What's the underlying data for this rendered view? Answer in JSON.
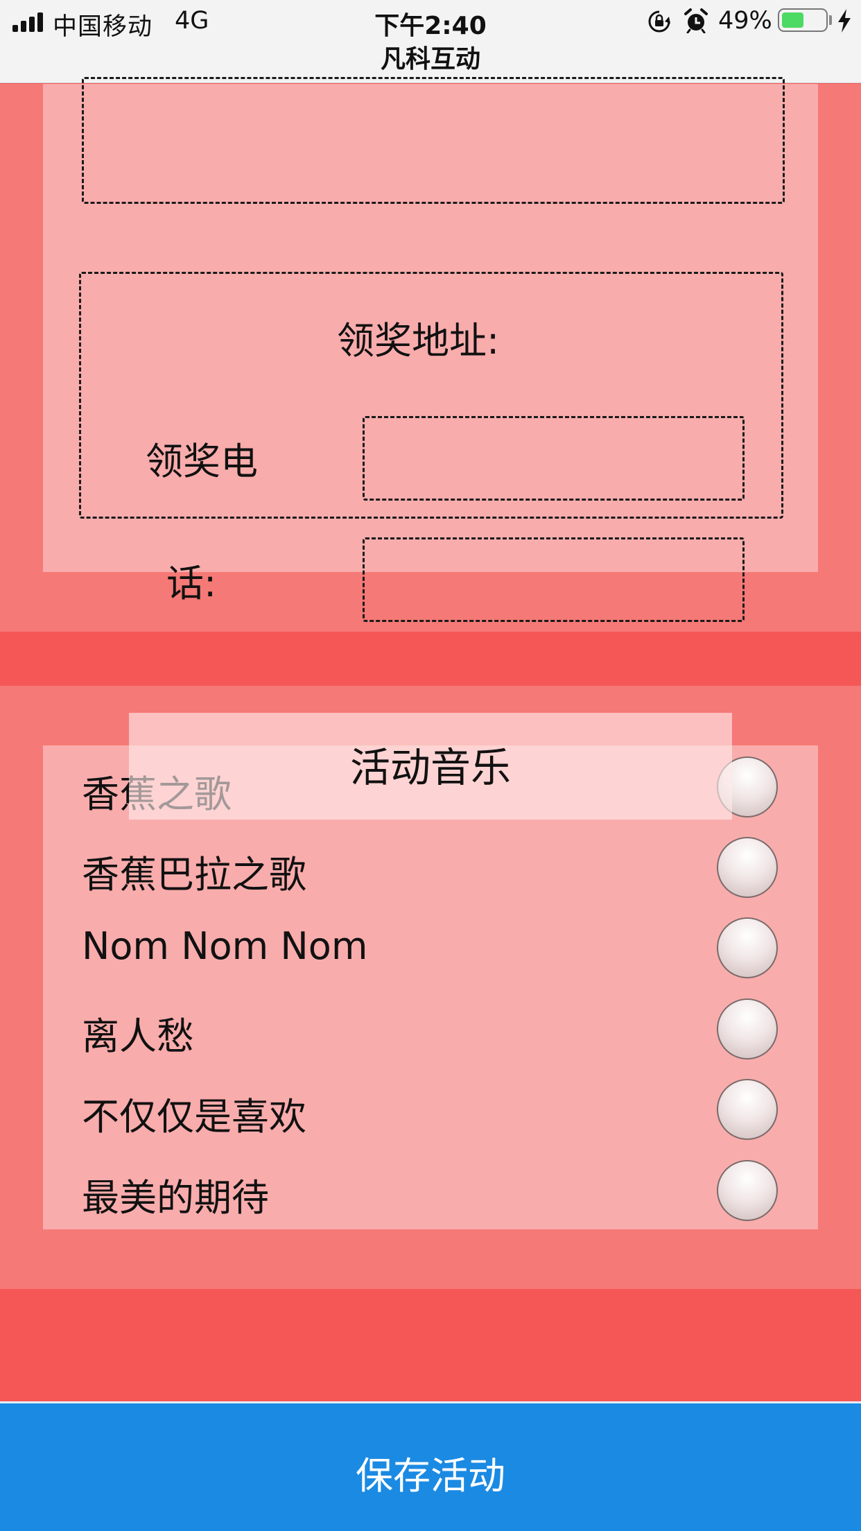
{
  "status_bar": {
    "carrier": "中国移动",
    "network": "4G",
    "time": "下午2:40",
    "battery_percent": "49%",
    "battery_level": 0.49,
    "icons": [
      "signal-icon",
      "orientation-lock-icon",
      "alarm-icon",
      "battery-icon",
      "charging-bolt-icon"
    ]
  },
  "app_title": "凡科互动",
  "prize_form": {
    "address_label": "领奖地址:",
    "phone_label_line1": "领奖电",
    "phone_label_line2": "话:"
  },
  "music": {
    "title": "活动音乐",
    "songs": [
      {
        "name": "香蕉之歌",
        "selected": false
      },
      {
        "name": "香蕉巴拉之歌",
        "selected": false
      },
      {
        "name": "Nom Nom Nom",
        "selected": false
      },
      {
        "name": "离人愁",
        "selected": false
      },
      {
        "name": "不仅仅是喜欢",
        "selected": false
      },
      {
        "name": "最美的期待",
        "selected": false
      }
    ]
  },
  "save_button": "保存活动",
  "colors": {
    "page_red": "#f55757",
    "section_pink": "#f57976",
    "panel_pink": "#f9acac",
    "save_blue": "#1b8ae3",
    "battery_green": "#4cd964"
  }
}
